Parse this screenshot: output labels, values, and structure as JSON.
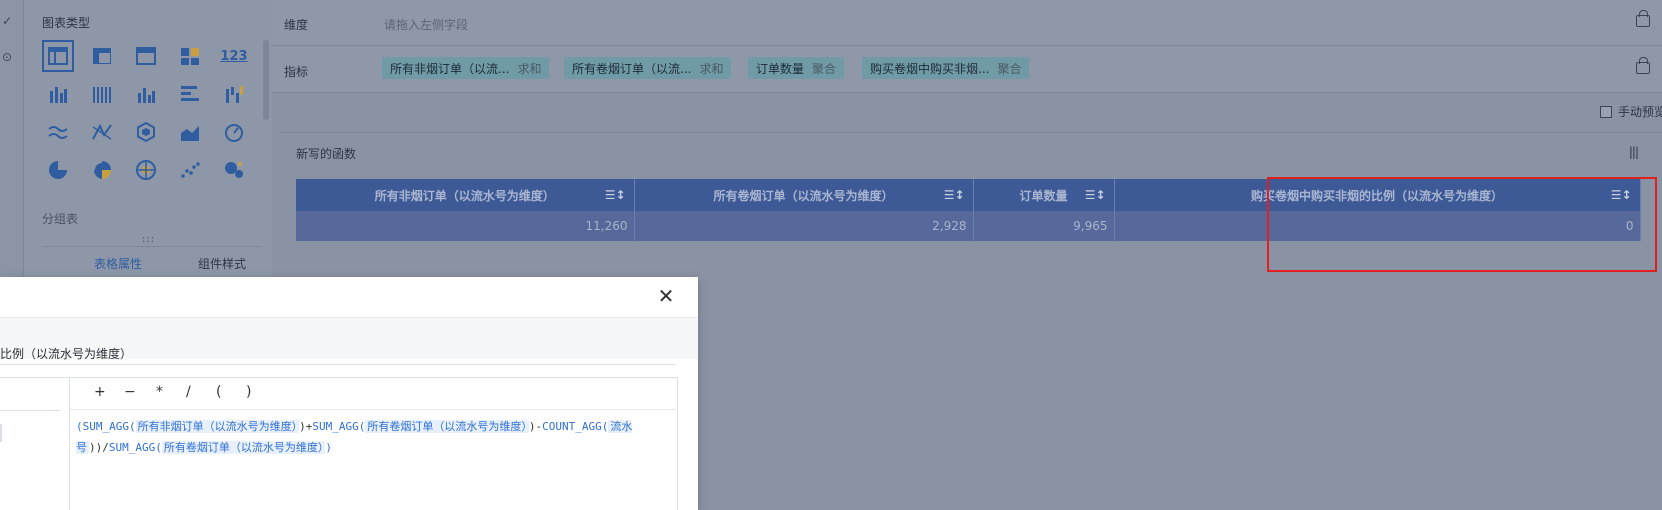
{
  "left_panel": {
    "title": "图表类型",
    "group_label": "分组表",
    "drag_handle": ":::",
    "tab_table_props": "表格属性",
    "tab_component_style": "组件样式",
    "first_chart_label": "123"
  },
  "dimension_row": {
    "label": "维度",
    "placeholder": "请拖入左侧字段"
  },
  "metric_row": {
    "label": "指标",
    "pills": [
      {
        "name": "所有非烟订单（以流...",
        "agg": "求和"
      },
      {
        "name": "所有卷烟订单（以流...",
        "agg": "求和"
      },
      {
        "name": "订单数量",
        "agg": "聚合"
      },
      {
        "name": "购买卷烟中购买非烟...",
        "agg": "聚合"
      }
    ]
  },
  "manual_preview_label": "手动预览",
  "card": {
    "title": "新写的函数",
    "icon_text": "|||",
    "columns": [
      "所有非烟订单（以流水号为维度）",
      "所有卷烟订单（以流水号为维度）",
      "订单数量",
      "购买卷烟中购买非烟的比例（以流水号为维度）"
    ],
    "row": [
      "11,260",
      "2,928",
      "9,965",
      "0"
    ]
  },
  "modal": {
    "close_symbol": "✕",
    "formula_name": "比例（以流水号为维度）",
    "operators": [
      "+",
      "−",
      "*",
      "/",
      "(",
      ")"
    ],
    "formula": {
      "p1": "(",
      "fn1": "SUM_AGG(",
      "f1": "所有非烟订单（以流水号为维度）",
      "p2": ")+",
      "fn2": "SUM_AGG(",
      "f2": "所有卷烟订单（以流水号为维度）",
      "p3": ")-",
      "fn3": "COUNT_AGG(",
      "f3": "流水号",
      "p4": "))/",
      "fn4": "SUM_AGG(",
      "f4": "所有卷烟订单（以流水号为维度）",
      "p5": ")"
    }
  }
}
